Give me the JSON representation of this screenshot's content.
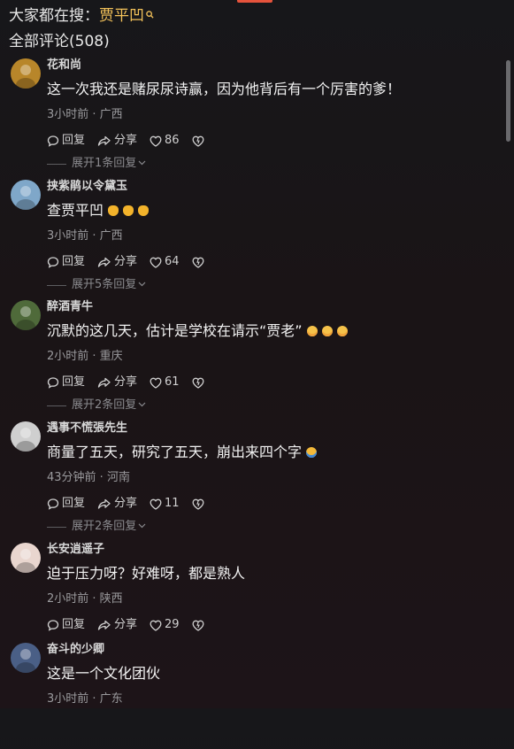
{
  "header": {
    "search_prefix": "大家都在搜：",
    "search_keyword": "贾平凹",
    "all_comments_label": "全部评论(508)"
  },
  "labels": {
    "reply": "回复",
    "share": "分享"
  },
  "comments": [
    {
      "username": "花和尚",
      "text": "这一次我还是赌尿尿诗赢，因为他背后有一个厉害的爹！",
      "meta": "3小时前 · 广西",
      "likes": "86",
      "expand": "展开1条回复",
      "emoji": [],
      "avatar_color": "#b8862a"
    },
    {
      "username": "挟紫鹃以令黛玉",
      "text": "查贾平凹",
      "meta": "3小时前 · 广西",
      "likes": "64",
      "expand": "展开5条回复",
      "emoji": [
        "clap",
        "clap",
        "clap"
      ],
      "avatar_color": "#7fa7c9"
    },
    {
      "username": "醉酒青牛",
      "text": "沉默的这几天，估计是学校在请示“贾老”",
      "meta": "2小时前 · 重庆",
      "likes": "61",
      "expand": "展开2条回复",
      "emoji": [
        "smile",
        "smile",
        "smile"
      ],
      "avatar_color": "#4f6a3a"
    },
    {
      "username": "遇事不慌張先生",
      "text": "商量了五天，研究了五天，崩出来四个字",
      "meta": "43分钟前 · 河南",
      "likes": "11",
      "expand": "展开2条回复",
      "emoji": [
        "laugh"
      ],
      "avatar_color": "#cfcfcf"
    },
    {
      "username": "长安逍遥子",
      "text": "迫于压力呀？好难呀，都是熟人",
      "meta": "2小时前 · 陕西",
      "likes": "29",
      "expand": "",
      "emoji": [],
      "avatar_color": "#e9d6cf"
    },
    {
      "username": "奋斗的少卿",
      "text": "这是一个文化团伙",
      "meta": "3小时前 · 广东",
      "likes": "",
      "expand": "",
      "emoji": [],
      "avatar_color": "#4a5f86"
    }
  ],
  "colors": {
    "keyword": "#f3c25a",
    "top_accent": "#e5533c"
  }
}
